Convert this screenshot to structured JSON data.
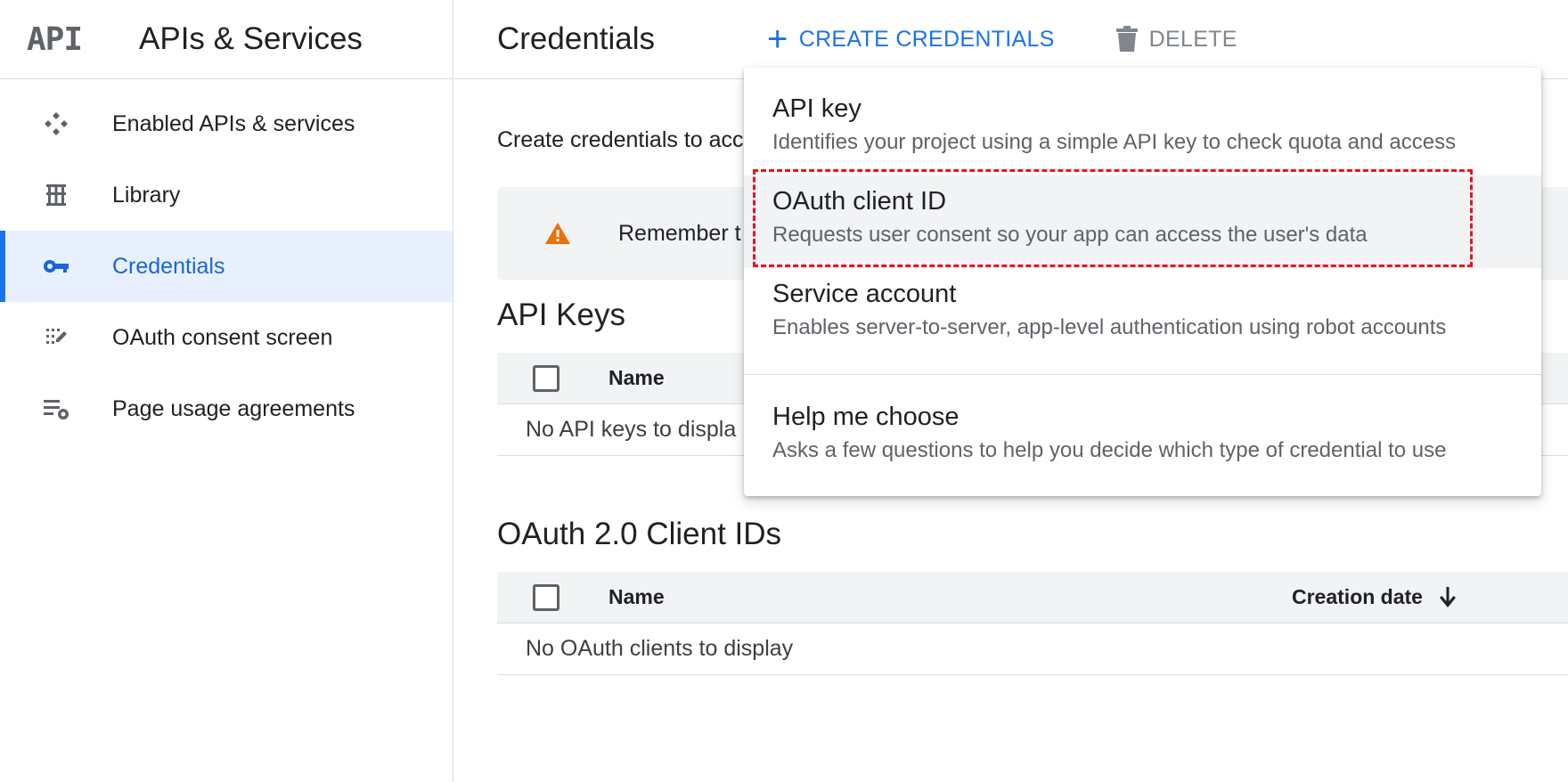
{
  "sidebar": {
    "logo": "API",
    "title": "APIs & Services",
    "items": [
      {
        "label": "Enabled APIs & services",
        "icon": "enabled-apis-icon",
        "active": false
      },
      {
        "label": "Library",
        "icon": "library-icon",
        "active": false
      },
      {
        "label": "Credentials",
        "icon": "key-icon",
        "active": true
      },
      {
        "label": "OAuth consent screen",
        "icon": "consent-screen-icon",
        "active": false
      },
      {
        "label": "Page usage agreements",
        "icon": "settings-list-icon",
        "active": false
      }
    ]
  },
  "header": {
    "title": "Credentials",
    "create_label": "CREATE CREDENTIALS",
    "delete_label": "DELETE"
  },
  "main": {
    "intro": "Create credentials to acc",
    "alert_text": "Remember t",
    "api_keys": {
      "title": "API Keys",
      "col_name": "Name",
      "empty": "No API keys to displa"
    },
    "oauth": {
      "title": "OAuth 2.0 Client IDs",
      "col_name": "Name",
      "col_date": "Creation date",
      "empty": "No OAuth clients to display"
    }
  },
  "menu": {
    "items": [
      {
        "title": "API key",
        "desc": "Identifies your project using a simple API key to check quota and access"
      },
      {
        "title": "OAuth client ID",
        "desc": "Requests user consent so your app can access the user's data"
      },
      {
        "title": "Service account",
        "desc": "Enables server-to-server, app-level authentication using robot accounts"
      },
      {
        "title": "Help me choose",
        "desc": "Asks a few questions to help you decide which type of credential to use"
      }
    ]
  },
  "colors": {
    "accent": "#1a73e8",
    "active_bg": "#e8f0fe",
    "warning": "#e8710a",
    "highlight": "#e8141f"
  }
}
